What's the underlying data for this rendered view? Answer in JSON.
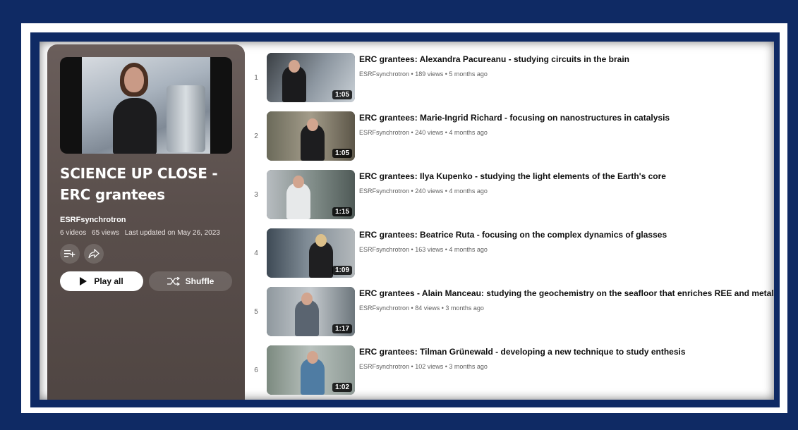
{
  "colors": {
    "frame": "#0f2a64",
    "panel": "#5e5350",
    "text": "#0f0f0f",
    "muted": "#606060"
  },
  "playlist": {
    "title": "SCIENCE UP CLOSE - ERC grantees",
    "channel": "ESRFsynchrotron",
    "video_count": "6 videos",
    "views": "65 views",
    "updated": "Last updated on May 26, 2023",
    "actions": {
      "save_icon": "add-to-queue-icon",
      "share_icon": "share-icon"
    },
    "play_all": "Play all",
    "shuffle": "Shuffle"
  },
  "videos": [
    {
      "index": "1",
      "title": "ERC grantees: Alexandra Pacureanu - studying circuits in the brain",
      "channel": "ESRFsynchrotron",
      "views": "189 views",
      "age": "5 months ago",
      "duration": "1:05"
    },
    {
      "index": "2",
      "title": "ERC grantees: Marie-Ingrid Richard - focusing on nanostructures in catalysis",
      "channel": "ESRFsynchrotron",
      "views": "240 views",
      "age": "4 months ago",
      "duration": "1:05"
    },
    {
      "index": "3",
      "title": "ERC grantees: Ilya Kupenko - studying the light elements of the Earth's core",
      "channel": "ESRFsynchrotron",
      "views": "240 views",
      "age": "4 months ago",
      "duration": "1:15"
    },
    {
      "index": "4",
      "title": "ERC grantees: Beatrice Ruta - focusing on the complex dynamics of glasses",
      "channel": "ESRFsynchrotron",
      "views": "163 views",
      "age": "4 months ago",
      "duration": "1:09"
    },
    {
      "index": "5",
      "title": "ERC grantees - Alain Manceau: studying the geochemistry on the seafloor that enriches REE and metals",
      "channel": "ESRFsynchrotron",
      "views": "84 views",
      "age": "3 months ago",
      "duration": "1:17"
    },
    {
      "index": "6",
      "title": "ERC grantees: Tilman Grünewald - developing a new technique to study enthesis",
      "channel": "ESRFsynchrotron",
      "views": "102 views",
      "age": "3 months ago",
      "duration": "1:02"
    }
  ]
}
